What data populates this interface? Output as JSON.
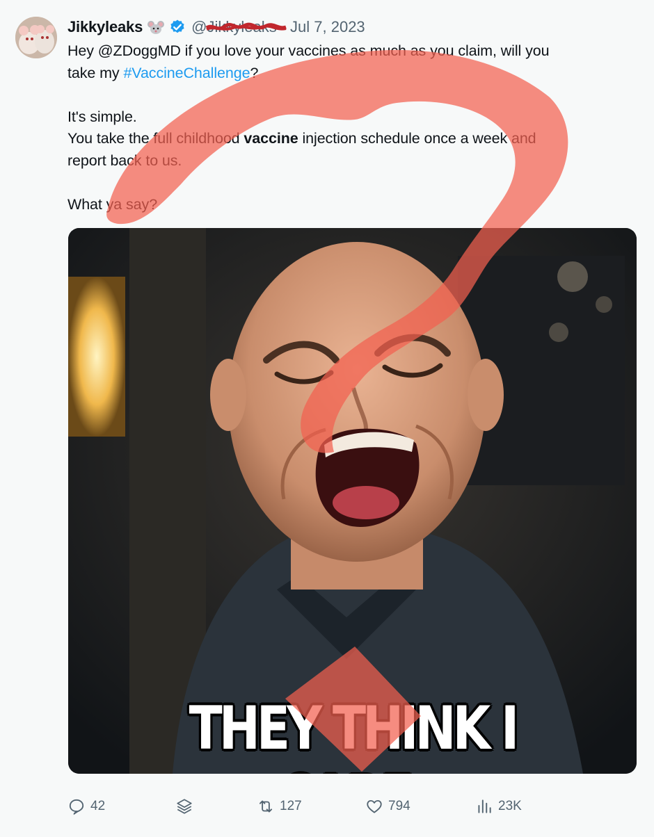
{
  "tweet": {
    "author_name": "Jikkyleaks",
    "author_emoji": "mouse-emoji",
    "verified": true,
    "handle": "@Jikkyleaks",
    "separator": "·",
    "date": "Jul 7, 2023",
    "text": {
      "line1": "Hey @ZDoggMD if you love your vaccines as much as you claim, will you",
      "line2_prefix": "take my ",
      "hashtag": "#VaccineChallenge",
      "line2_suffix": "?",
      "line3": "It's simple.",
      "line4_prefix": "You take the full childhood ",
      "line4_bold": "vaccine",
      "line4_suffix": " injection schedule once a week and",
      "line5": "report back to us.",
      "line6": "What ya say?"
    },
    "media": {
      "caption": "THEY THINK I CARE."
    },
    "actions": {
      "replies": "42",
      "retweets": "127",
      "likes": "794",
      "views": "23K"
    }
  },
  "colors": {
    "background": "#f7f9f9",
    "text": "#0f1419",
    "secondary": "#536471",
    "link": "#1d9bf0",
    "verified": "#1d9bf0",
    "overlay_marker": "#f2604f"
  },
  "icons": {
    "reply": "reply-icon",
    "grok": "stack-icon",
    "retweet": "retweet-icon",
    "like": "heart-icon",
    "views": "bar-chart-icon",
    "verified": "verified-badge-icon"
  }
}
